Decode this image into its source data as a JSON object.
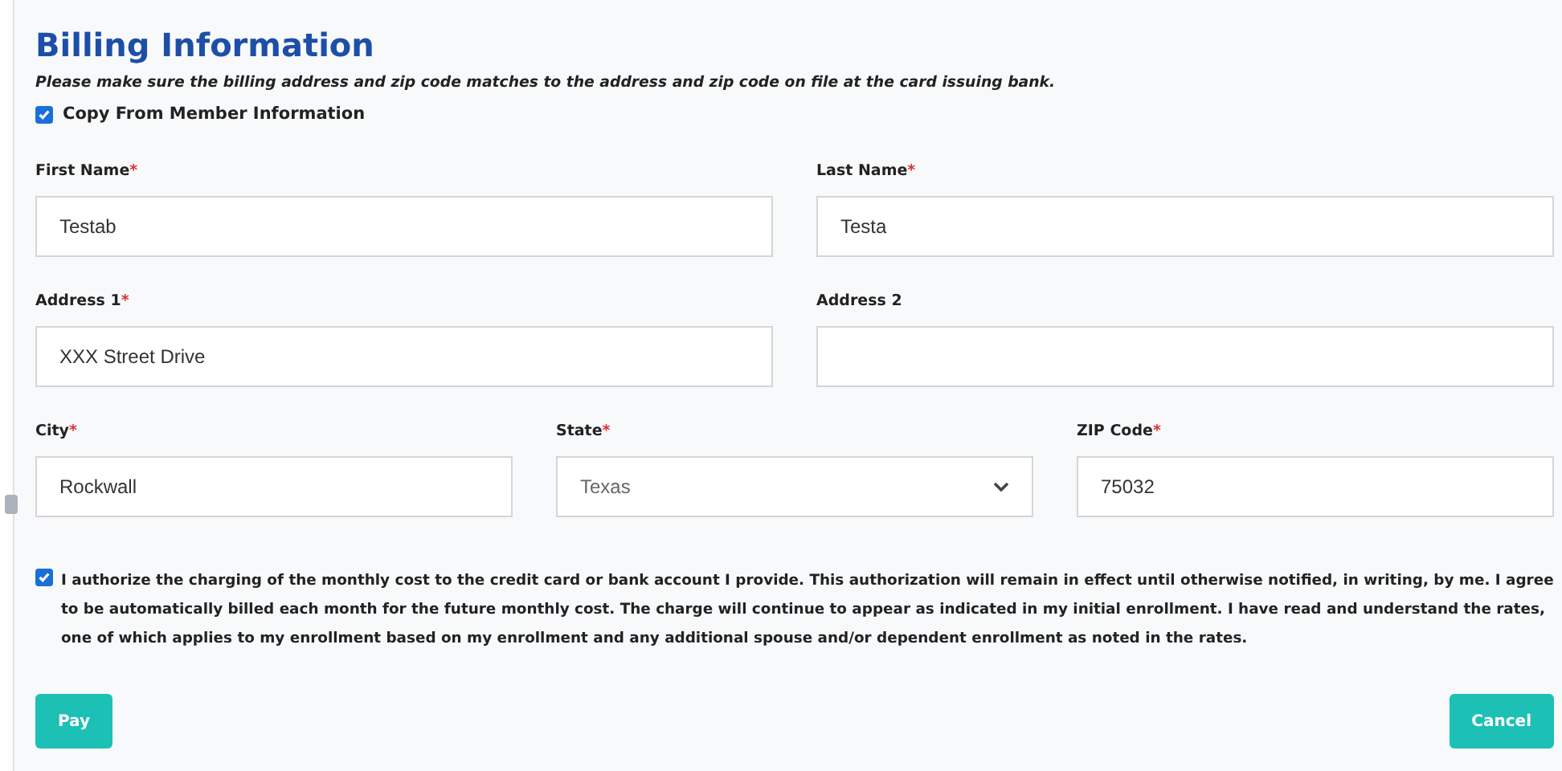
{
  "title": "Billing Information",
  "note": "Please make sure the billing address and zip code matches to the address and zip code on file at the card issuing bank.",
  "copy_option": {
    "label": "Copy From Member Information",
    "checked": true
  },
  "rows": [
    {
      "fields": [
        {
          "kind": "text",
          "label": "First Name",
          "required_mark": "*",
          "value": "Testab"
        },
        {
          "kind": "text",
          "label": "Last Name",
          "required_mark": "*",
          "value": "Testa"
        }
      ]
    },
    {
      "fields": [
        {
          "kind": "text",
          "label": "Address 1",
          "required_mark": "*",
          "value": "XXX Street Drive"
        },
        {
          "kind": "text",
          "label": "Address 2"
        }
      ]
    },
    {
      "fields": [
        {
          "kind": "text",
          "label": "City",
          "required_mark": "*",
          "value": "Rockwall"
        },
        {
          "kind": "select",
          "label": "State",
          "required_mark": "*",
          "value": "Texas"
        },
        {
          "kind": "text",
          "label": "ZIP Code",
          "required_mark": "*",
          "value": "75032"
        }
      ]
    }
  ],
  "authorization": {
    "checked": true,
    "text": "I authorize the charging of the monthly cost to the credit card or bank account I provide. This authorization will remain in effect until otherwise notified, in writing, by me. I agree to be automatically billed each month for the future monthly cost. The charge will continue to appear as indicated in my initial enrollment. I have read and understand the rates, one of which applies to my enrollment based on my enrollment and any additional spouse and/or dependent enrollment as noted in the rates."
  },
  "buttons": [
    {
      "label": "Pay"
    },
    {
      "label": "Cancel"
    }
  ]
}
